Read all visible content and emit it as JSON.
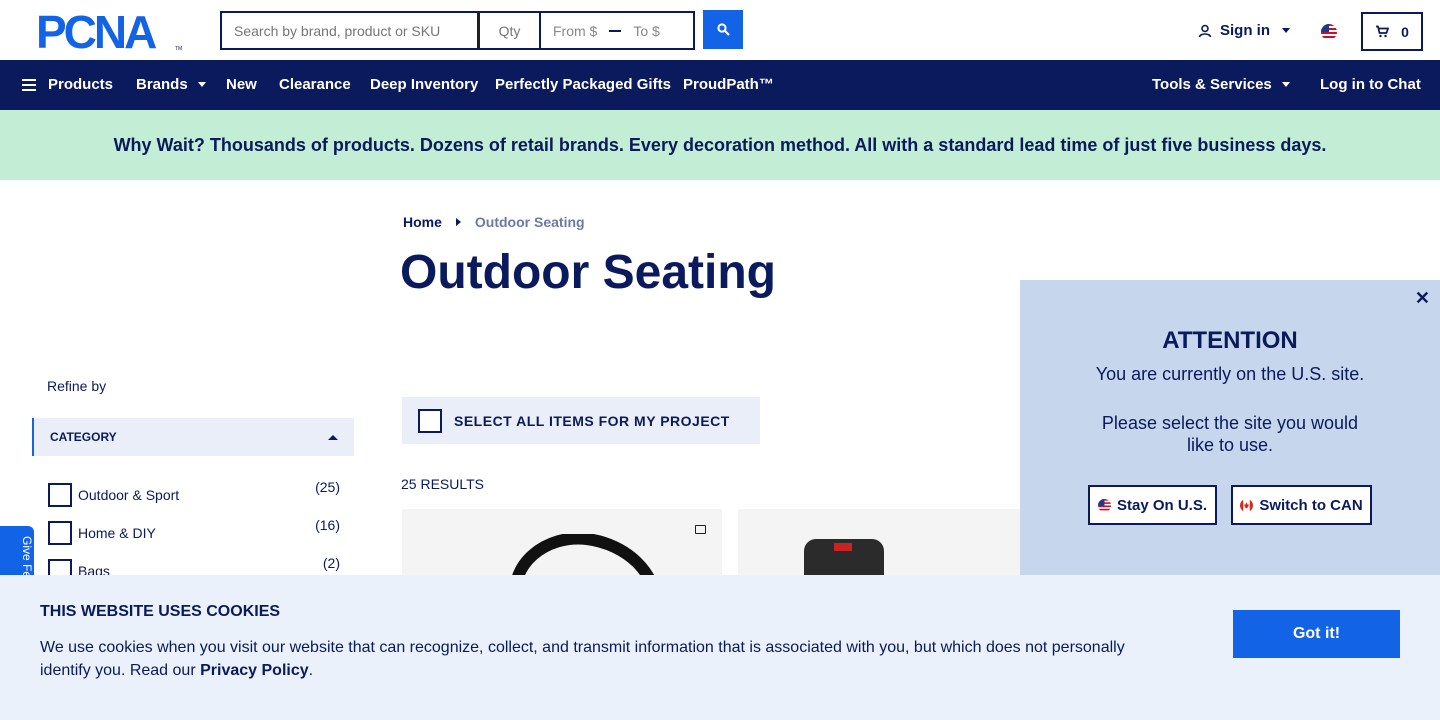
{
  "header": {
    "logo_text": "PCNA",
    "search_placeholder": "Search by brand, product or SKU",
    "qty_placeholder": "Qty",
    "price_from": "From $",
    "price_to": "To $",
    "sign_in": "Sign in",
    "cart_count": "0"
  },
  "nav": {
    "products": "Products",
    "brands": "Brands",
    "new": "New",
    "clearance": "Clearance",
    "deep_inventory": "Deep Inventory",
    "gifts": "Perfectly Packaged Gifts",
    "proudpath": "ProudPath™",
    "tools": "Tools & Services",
    "chat": "Log in to Chat"
  },
  "banner": {
    "text": "Why Wait? Thousands of products. Dozens of retail brands. Every decoration method. All with a standard lead time of just five business days."
  },
  "breadcrumb": {
    "home": "Home",
    "current": "Outdoor Seating"
  },
  "page_title": "Outdoor Seating",
  "sidebar": {
    "refine": "Refine by",
    "category_header": "CATEGORY",
    "categories": [
      {
        "label": "Outdoor & Sport",
        "count": "(25)"
      },
      {
        "label": "Home & DIY",
        "count": "(16)"
      },
      {
        "label": "Bags",
        "count": "(2)"
      }
    ],
    "feedback": "Give Fe"
  },
  "results": {
    "select_all": "SELECT ALL ITEMS FOR MY PROJECT",
    "count": "25 RESULTS"
  },
  "attention": {
    "title": "ATTENTION",
    "line1": "You are currently on the U.S. site.",
    "line2": "Please select the site you would like to use.",
    "stay": "Stay On U.S.",
    "switch": "Switch to CAN"
  },
  "cookie": {
    "title": "THIS WEBSITE USES COOKIES",
    "text": "We use cookies when you visit our website that can recognize, collect, and transmit information that is associated with you, but which does not personally identify you. Read our",
    "link": "Privacy Policy",
    "period": ".",
    "button": "Got it!"
  },
  "colors": {
    "navy": "#0a1a5c",
    "blue": "#1363e6",
    "banner": "#c3eed5"
  }
}
